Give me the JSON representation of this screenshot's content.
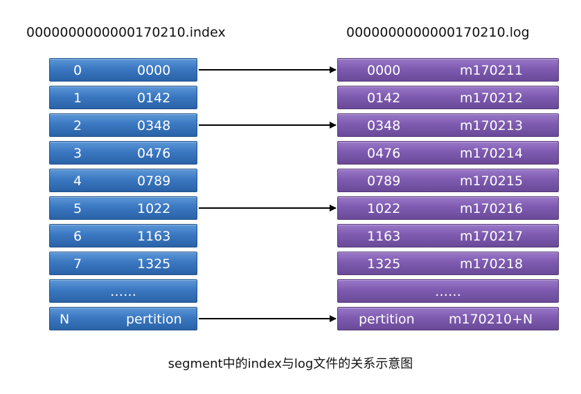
{
  "index_file": {
    "title": "0000000000000170210.index",
    "rows": [
      {
        "num": "0",
        "offset": "0000"
      },
      {
        "num": "1",
        "offset": "0142"
      },
      {
        "num": "2",
        "offset": "0348"
      },
      {
        "num": "3",
        "offset": "0476"
      },
      {
        "num": "4",
        "offset": "0789"
      },
      {
        "num": "5",
        "offset": "1022"
      },
      {
        "num": "6",
        "offset": "1163"
      },
      {
        "num": "7",
        "offset": "1325"
      }
    ],
    "ellipsis": "……",
    "last_row": {
      "num": "N",
      "offset": "pertition"
    }
  },
  "log_file": {
    "title": "0000000000000170210.log",
    "rows": [
      {
        "offset": "0000",
        "message": "m170211"
      },
      {
        "offset": "0142",
        "message": "m170212"
      },
      {
        "offset": "0348",
        "message": "m170213"
      },
      {
        "offset": "0476",
        "message": "m170214"
      },
      {
        "offset": "0789",
        "message": "m170215"
      },
      {
        "offset": "1022",
        "message": "m170216"
      },
      {
        "offset": "1163",
        "message": "m170217"
      },
      {
        "offset": "1325",
        "message": "m170218"
      }
    ],
    "ellipsis": "……",
    "last_row": {
      "offset": "pertition",
      "message": "m170210+N"
    }
  },
  "caption": "segment中的index与log文件的关系示意图",
  "colors": {
    "index_row": "#3b78c2",
    "log_row": "#7e5bb0",
    "arrow": "#000000"
  }
}
